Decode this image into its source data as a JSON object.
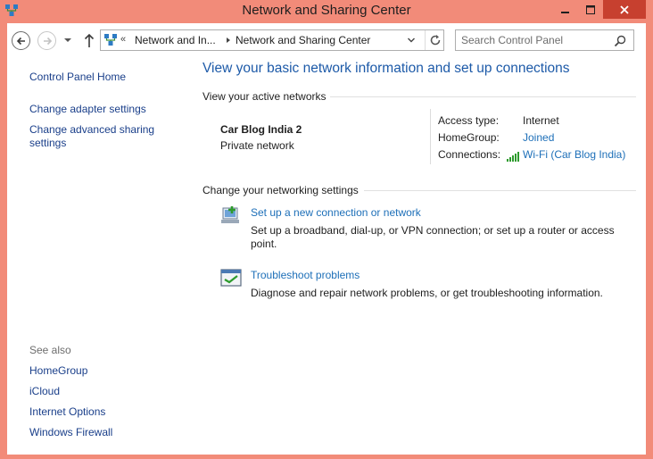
{
  "window": {
    "title": "Network and Sharing Center",
    "controls": {
      "minimize": "minimize",
      "maximize": "maximize",
      "close": "close"
    }
  },
  "navbar": {
    "back_icon": "back-arrow",
    "forward_icon": "forward-arrow",
    "up_icon": "up-arrow",
    "address": {
      "overflow": "«",
      "crumbs": [
        "Network and In...",
        "Network and Sharing Center"
      ]
    },
    "search": {
      "placeholder": "Search Control Panel"
    }
  },
  "sidebar": {
    "items": [
      "Control Panel Home",
      "Change adapter settings",
      "Change advanced sharing settings"
    ],
    "see_also_label": "See also",
    "see_also": [
      "HomeGroup",
      "iCloud",
      "Internet Options",
      "Windows Firewall"
    ]
  },
  "main": {
    "title": "View your basic network information and set up connections",
    "active_networks": {
      "heading": "View your active networks",
      "network_name": "Car Blog India  2",
      "network_type": "Private network",
      "access_type_label": "Access type:",
      "access_type": "Internet",
      "homegroup_label": "HomeGroup:",
      "homegroup": "Joined",
      "connections_label": "Connections:",
      "connection": "Wi-Fi (Car Blog India)"
    },
    "settings": {
      "heading": "Change your networking settings",
      "tasks": [
        {
          "link": "Set up a new connection or network",
          "desc": "Set up a broadband, dial-up, or VPN connection; or set up a router or access point.",
          "icon": "new-connection-icon"
        },
        {
          "link": "Troubleshoot problems",
          "desc": "Diagnose and repair network problems, or get troubleshooting information.",
          "icon": "troubleshoot-icon"
        }
      ]
    }
  },
  "colors": {
    "window_frame": "#f28b79",
    "close_button": "#c7402f",
    "title_blue": "#1d5aa8",
    "link_blue": "#1d6fb8"
  }
}
